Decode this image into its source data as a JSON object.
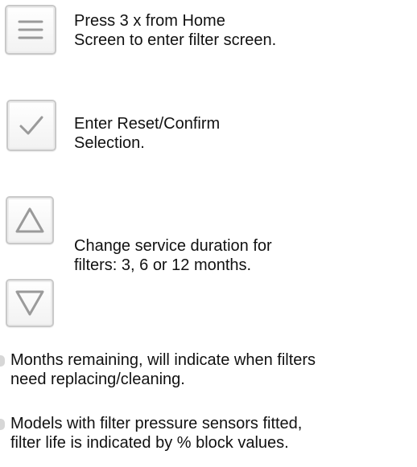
{
  "items": [
    {
      "icon": "menu-icon",
      "text": "Press 3 x from Home\nScreen to enter filter screen."
    },
    {
      "icon": "checkmark-icon",
      "text": "Enter Reset/Confirm\nSelection."
    },
    {
      "icon": "up-triangle-icon",
      "icon2": "down-triangle-icon",
      "text": "Change service duration for\nfilters: 3, 6 or 12 months."
    }
  ],
  "notes": [
    "Months remaining, will indicate when filters\nneed replacing/cleaning.",
    "Models with filter pressure sensors fitted,\nfilter life is indicated by % block values."
  ],
  "colors": {
    "icon_stroke": "#9a9a9a",
    "icon_border": "#c9c9c9",
    "text": "#111111"
  }
}
